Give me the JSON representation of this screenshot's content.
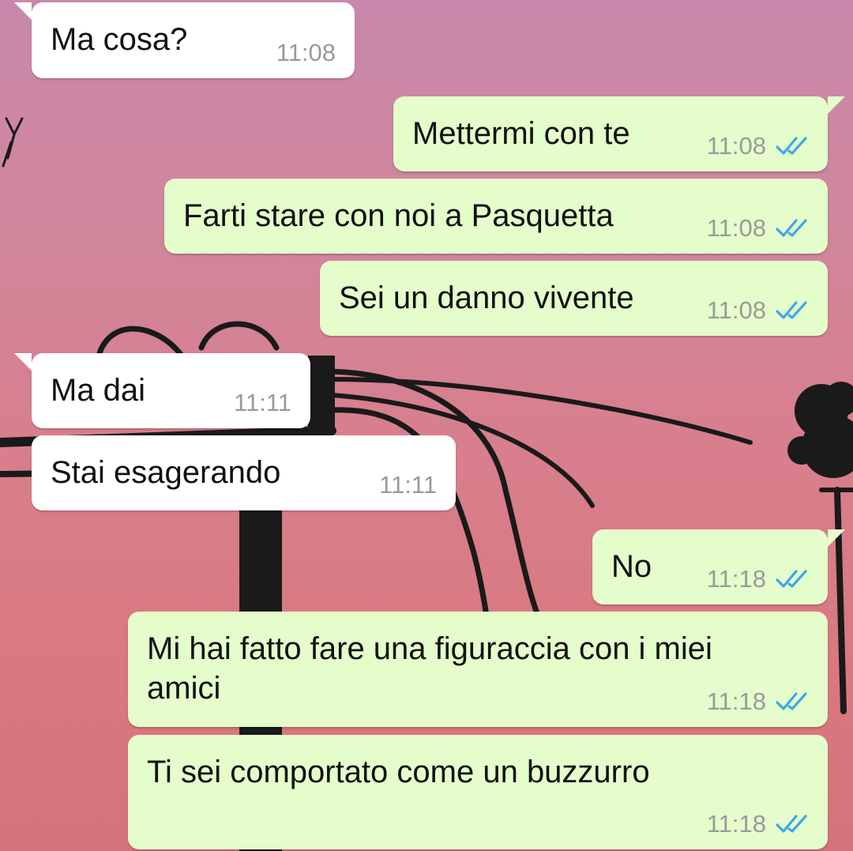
{
  "colors": {
    "incoming_bubble": "#ffffff",
    "outgoing_bubble": "#e4fdcb",
    "timestamp": "#9a9a9a",
    "read_ticks": "#3fa7e8",
    "wallpaper": "#cf849c"
  },
  "messages": [
    {
      "text": "Ma cosa?",
      "time": "11:08",
      "direction": "incoming",
      "status_icon": null
    },
    {
      "text": "Mettermi con te",
      "time": "11:08",
      "direction": "outgoing",
      "status_icon": "read-double-check-icon"
    },
    {
      "text": "Farti stare con noi a Pasquetta",
      "time": "11:08",
      "direction": "outgoing",
      "status_icon": "read-double-check-icon"
    },
    {
      "text": "Sei un danno vivente",
      "time": "11:08",
      "direction": "outgoing",
      "status_icon": "read-double-check-icon"
    },
    {
      "text": "Ma dai",
      "time": "11:11",
      "direction": "incoming",
      "status_icon": null
    },
    {
      "text": "Stai esagerando",
      "time": "11:11",
      "direction": "incoming",
      "status_icon": null
    },
    {
      "text": "No",
      "time": "11:18",
      "direction": "outgoing",
      "status_icon": "read-double-check-icon"
    },
    {
      "text": "Mi hai fatto fare una figuraccia con i miei amici",
      "time": "11:18",
      "direction": "outgoing",
      "status_icon": "read-double-check-icon"
    },
    {
      "text": "Ti sei comportato come un buzzurro",
      "time": "11:18",
      "direction": "outgoing",
      "status_icon": "read-double-check-icon"
    }
  ]
}
